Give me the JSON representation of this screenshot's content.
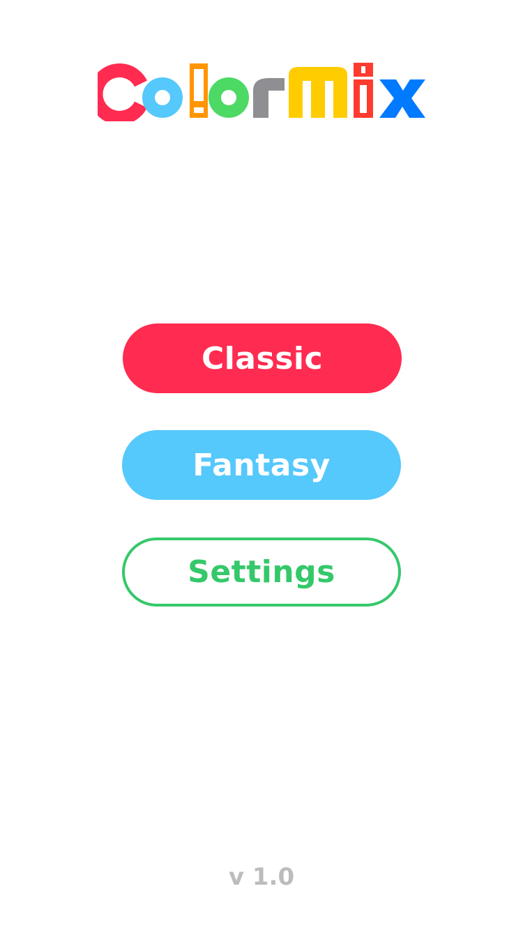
{
  "app": {
    "logo_text": "ColorMix",
    "logo_colors": [
      "#ff2b50",
      "#55c8fc",
      "#ff9500",
      "#4cd964",
      "#8e8e93",
      "#ffcc00",
      "#ff3b30",
      "#007aff"
    ]
  },
  "menu": {
    "classic_label": "Classic",
    "fantasy_label": "Fantasy",
    "settings_label": "Settings"
  },
  "colors": {
    "classic_bg": "#ff2b50",
    "fantasy_bg": "#55c8fc",
    "settings_accent": "#35c86a",
    "version_text": "#bcbcbc"
  },
  "footer": {
    "version": "v 1.0"
  }
}
